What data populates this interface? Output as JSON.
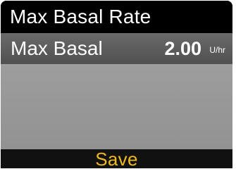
{
  "screen": {
    "title": "Max Basal Rate"
  },
  "setting": {
    "label": "Max Basal",
    "value": "2.00",
    "unit": "U/hr"
  },
  "action": {
    "save_label": "Save"
  },
  "colors": {
    "background": "#000000",
    "content": "#9b9b9b",
    "selected_row": "#5a5a5a",
    "text": "#ffffff",
    "accent": "#f0b91e"
  }
}
